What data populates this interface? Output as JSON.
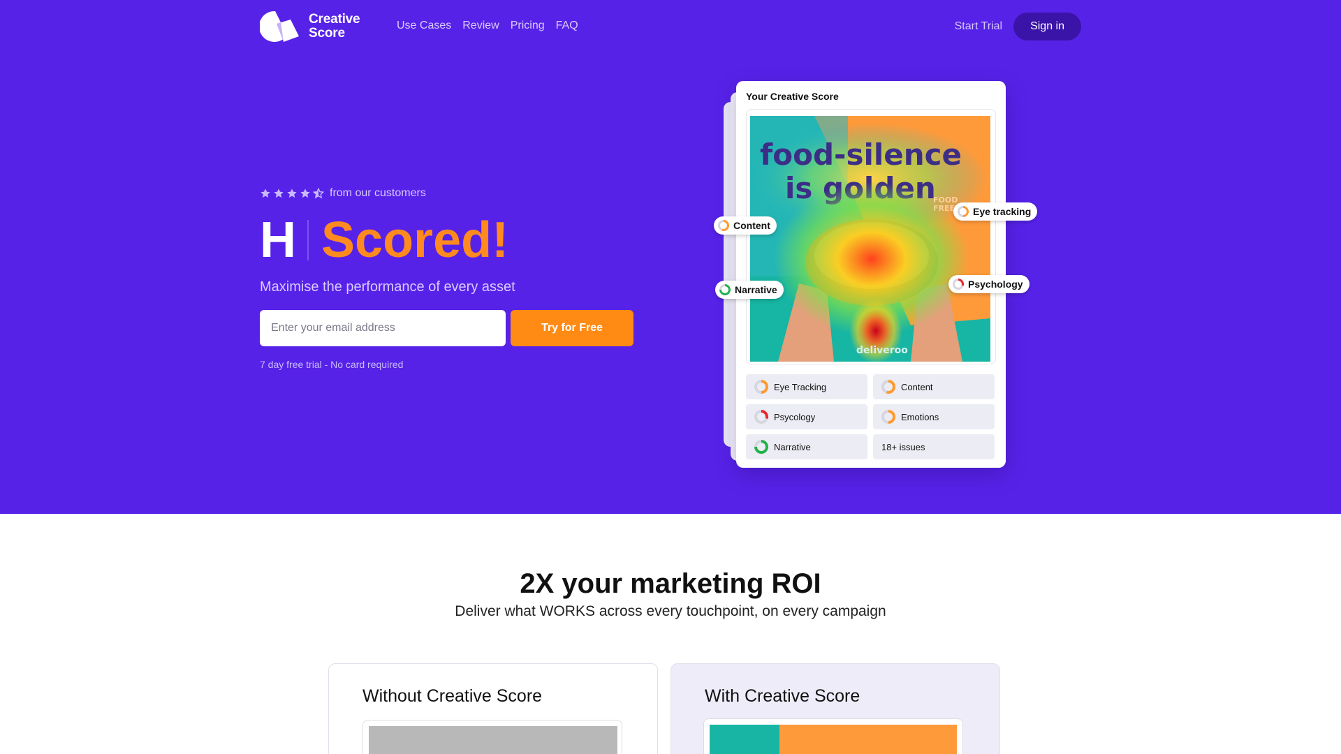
{
  "colors": {
    "hero_bg": "#5722e8",
    "accent": "#ff8a14",
    "sign_in_bg": "#3a14a8"
  },
  "nav": {
    "logo_line1": "Creative",
    "logo_line2": "Score",
    "links": [
      "Use Cases",
      "Review",
      "Pricing",
      "FAQ"
    ],
    "start_trial": "Start Trial",
    "sign_in": "Sign in"
  },
  "hero": {
    "rating_stars": 4.5,
    "rating_text": "from our customers",
    "headline_prefix": "H",
    "headline_highlight": "Scored!",
    "subhead": "Maximise the performance of every asset",
    "email_placeholder": "Enter your email address",
    "cta": "Try for Free",
    "trial_note": "7 day free trial - No card required"
  },
  "score_card": {
    "title": "Your Creative Score",
    "ad_text_line1": "food-silence",
    "ad_text_line2": "is golden",
    "ad_small_text_1": "FOOD",
    "ad_small_text_2": "FREE",
    "ad_brand": "deliveroo",
    "pills": {
      "content": "Content",
      "eye_tracking": "Eye tracking",
      "narrative": "Narrative",
      "psychology": "Psychology"
    },
    "metrics": {
      "eye_tracking": "Eye Tracking",
      "content": "Content",
      "psycology": "Psycology",
      "emotions": "Emotions",
      "narrative": "Narrative",
      "issues": "18+ issues"
    }
  },
  "roi": {
    "title": "2X your marketing ROI",
    "subtitle": "Deliver what WORKS across every touchpoint, on every campaign",
    "without_title": "Without Creative Score",
    "with_title": "With Creative Score"
  }
}
